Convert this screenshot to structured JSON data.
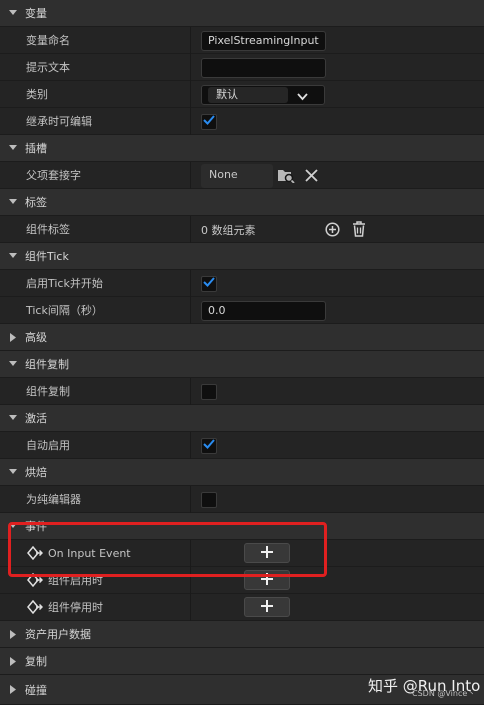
{
  "sections": {
    "variable": "变量",
    "slot": "插槽",
    "tags": "标签",
    "component_tick": "组件Tick",
    "advanced": "高级",
    "replication": "组件复制",
    "activation": "激活",
    "cooking": "烘焙",
    "events": "事件",
    "asset_user_data": "资产用户数据",
    "copy": "复制",
    "collision": "碰撞"
  },
  "props": {
    "var_name_label": "变量命名",
    "var_name_value": "PixelStreamingInput",
    "tooltip_label": "提示文本",
    "tooltip_value": "",
    "category_label": "类别",
    "category_value": "默认",
    "editable_label": "继承时可编辑",
    "editable_checked": true,
    "parent_socket_label": "父项套接字",
    "parent_socket_value": "None",
    "component_tags_label": "组件标签",
    "component_tags_value": "0 数组元素",
    "start_tick_label": "启用Tick并开始",
    "start_tick_checked": true,
    "tick_interval_label": "Tick间隔（秒）",
    "tick_interval_value": "0.0",
    "replicates_label": "组件复制",
    "replicates_checked": false,
    "auto_activate_label": "自动启用",
    "auto_activate_checked": true,
    "editor_only_label": "为纯编辑器",
    "editor_only_checked": false
  },
  "events": [
    {
      "label": "On Input Event"
    },
    {
      "label": "组件启用时"
    },
    {
      "label": "组件停用时"
    }
  ],
  "watermark": {
    "main": "知乎 @Run Into",
    "sub": "CSDN @Vince丶"
  },
  "colors": {
    "check_blue": "#2a8cf0",
    "highlight_red": "#e02020"
  }
}
